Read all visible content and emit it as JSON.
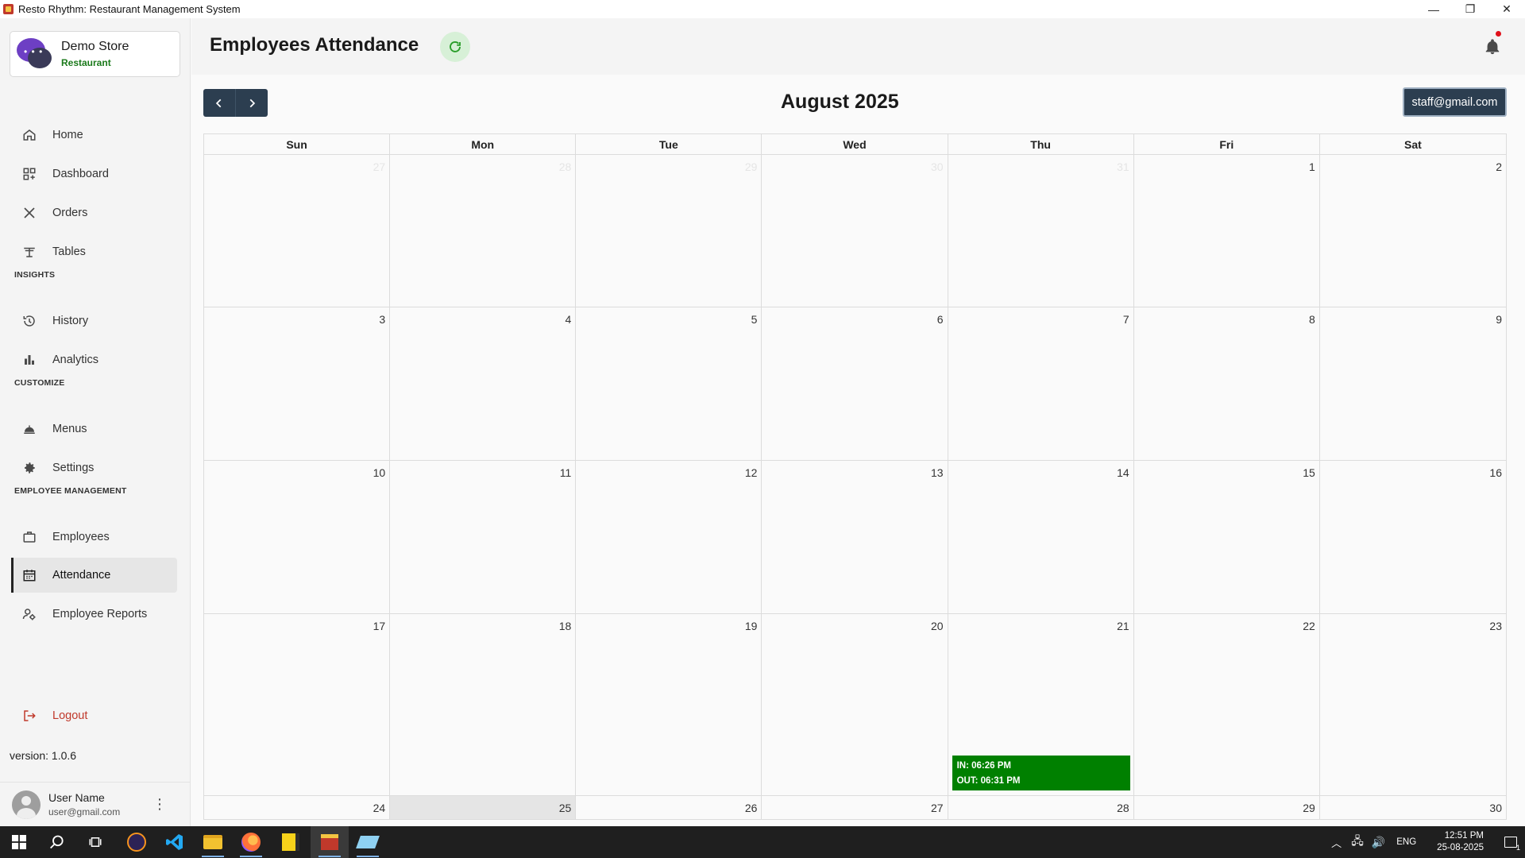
{
  "window": {
    "title": "Resto Rhythm: Restaurant Management System",
    "minimize": "—",
    "restore": "❐",
    "close": "✕"
  },
  "sidebar": {
    "store_name": "Demo Store",
    "store_type": "Restaurant",
    "items_main": [
      {
        "label": "Home",
        "icon": "home-icon"
      },
      {
        "label": "Dashboard",
        "icon": "dashboard-icon"
      },
      {
        "label": "Orders",
        "icon": "utensils-icon"
      },
      {
        "label": "Tables",
        "icon": "table-icon"
      }
    ],
    "section_insights": "INSIGHTS",
    "items_insights": [
      {
        "label": "History",
        "icon": "history-icon"
      },
      {
        "label": "Analytics",
        "icon": "bar-chart-icon"
      }
    ],
    "section_customize": "CUSTOMIZE",
    "items_customize": [
      {
        "label": "Menus",
        "icon": "cloche-icon"
      },
      {
        "label": "Settings",
        "icon": "gear-icon"
      }
    ],
    "section_employee": "EMPLOYEE MANAGEMENT",
    "items_employee": [
      {
        "label": "Employees",
        "icon": "briefcase-icon"
      },
      {
        "label": "Attendance",
        "icon": "calendar-icon",
        "active": true
      },
      {
        "label": "Employee Reports",
        "icon": "user-report-icon"
      }
    ],
    "logout": "Logout",
    "version": "version: 1.0.6",
    "user_name": "User Name",
    "user_email": "user@gmail.com"
  },
  "header": {
    "title": "Employees Attendance"
  },
  "calendar": {
    "month": "August 2025",
    "staff_filter": "staff@gmail.com",
    "weekdays": [
      "Sun",
      "Mon",
      "Tue",
      "Wed",
      "Thu",
      "Fri",
      "Sat"
    ],
    "weeks": [
      [
        {
          "d": "27",
          "other": true
        },
        {
          "d": "28",
          "other": true
        },
        {
          "d": "29",
          "other": true
        },
        {
          "d": "30",
          "other": true
        },
        {
          "d": "31",
          "other": true
        },
        {
          "d": "1"
        },
        {
          "d": "2"
        }
      ],
      [
        {
          "d": "3"
        },
        {
          "d": "4"
        },
        {
          "d": "5"
        },
        {
          "d": "6"
        },
        {
          "d": "7"
        },
        {
          "d": "8"
        },
        {
          "d": "9"
        }
      ],
      [
        {
          "d": "10"
        },
        {
          "d": "11"
        },
        {
          "d": "12"
        },
        {
          "d": "13"
        },
        {
          "d": "14"
        },
        {
          "d": "15"
        },
        {
          "d": "16"
        }
      ],
      [
        {
          "d": "17"
        },
        {
          "d": "18"
        },
        {
          "d": "19"
        },
        {
          "d": "20"
        },
        {
          "d": "21",
          "event": {
            "in": "IN: 06:26 PM",
            "out": "OUT: 06:31 PM"
          }
        },
        {
          "d": "22"
        },
        {
          "d": "23"
        }
      ],
      [
        {
          "d": "24"
        },
        {
          "d": "25",
          "today": true
        },
        {
          "d": "26"
        },
        {
          "d": "27"
        },
        {
          "d": "28"
        },
        {
          "d": "29"
        },
        {
          "d": "30"
        }
      ]
    ],
    "event_color": "#008000"
  },
  "taskbar": {
    "lang": "ENG",
    "time": "12:51 PM",
    "date": "25-08-2025",
    "notification_count": "1"
  }
}
